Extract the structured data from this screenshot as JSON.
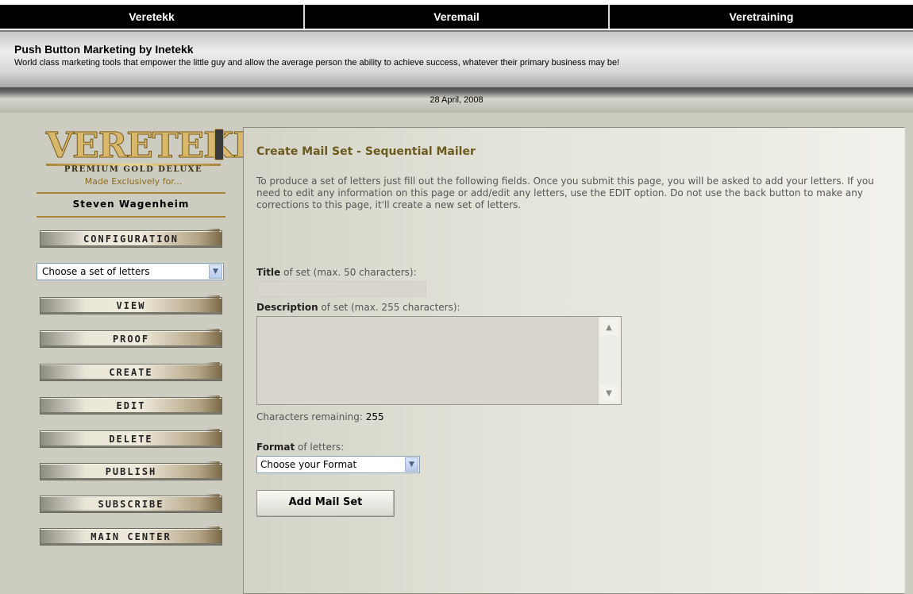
{
  "topnav": {
    "items": [
      "Veretekk",
      "Veremail",
      "Veretraining"
    ]
  },
  "header": {
    "title": "Push Button Marketing by Inetekk",
    "tagline": "World class marketing tools that empower the little guy and allow the average person the ability to achieve success, whatever their primary business may be!"
  },
  "date": "28 April, 2008",
  "sidebar": {
    "logo": "VERETEKK",
    "premium": "PREMIUM GOLD DELUXE",
    "made_for": "Made Exclusively for...",
    "username": "Steven Wagenheim",
    "config_label": "CONFIGURATION",
    "set_select": "Choose a set of letters",
    "buttons": [
      "VIEW",
      "PROOF",
      "CREATE",
      "EDIT",
      "DELETE",
      "PUBLISH",
      "SUBSCRIBE",
      "MAIN CENTER"
    ]
  },
  "content": {
    "title": "Create Mail Set - Sequential Mailer",
    "intro": "To produce a set of letters just fill out the following fields. Once you submit this page, you will be asked to add your letters. If you need to edit any information on this page or add/edit any letters, use the EDIT option. Do not use the back button to make any corrections to this page, it'll create a new set of letters.",
    "title_label_bold": "Title",
    "title_label_rest": " of set (max. 50 characters):",
    "title_value": "",
    "desc_label_bold": "Description",
    "desc_label_rest": " of set (max. 255 characters):",
    "desc_value": "",
    "chars_label": "Characters remaining:",
    "chars_count": "255",
    "format_label_bold": "Format",
    "format_label_rest": " of letters:",
    "format_select": "Choose your Format",
    "submit": "Add Mail Set"
  }
}
